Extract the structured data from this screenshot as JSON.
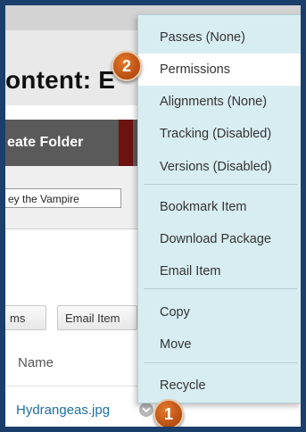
{
  "page": {
    "title": "ontent: E",
    "action_bar": {
      "create_folder_label": "eate Folder"
    },
    "search": {
      "value": "ey the Vampire"
    },
    "toolbar": {
      "items_label": "ms",
      "email_item_label": "Email Item"
    },
    "table": {
      "name_header": "Name"
    },
    "file": {
      "name": "Hydrangeas.jpg"
    }
  },
  "context_menu": {
    "items": [
      {
        "label": "Passes (None)"
      },
      {
        "label": "Permissions",
        "active": true
      },
      {
        "label": "Alignments (None)"
      },
      {
        "label": "Tracking (Disabled)"
      },
      {
        "label": "Versions (Disabled)"
      },
      {
        "label": "Bookmark Item"
      },
      {
        "label": "Download Package"
      },
      {
        "label": "Email Item"
      },
      {
        "label": "Copy"
      },
      {
        "label": "Move"
      },
      {
        "label": "Recycle"
      }
    ]
  },
  "callouts": {
    "step1": "1",
    "step2": "2"
  },
  "colors": {
    "frame_border": "#1a3f6b",
    "menu_background": "#d8edf2",
    "menu_active": "#ffffff",
    "callout": "#d0641e",
    "link": "#1d6fa5",
    "action_bar": "#5a5a5a"
  },
  "icons": {
    "row_menu": "chevron-down-icon"
  }
}
